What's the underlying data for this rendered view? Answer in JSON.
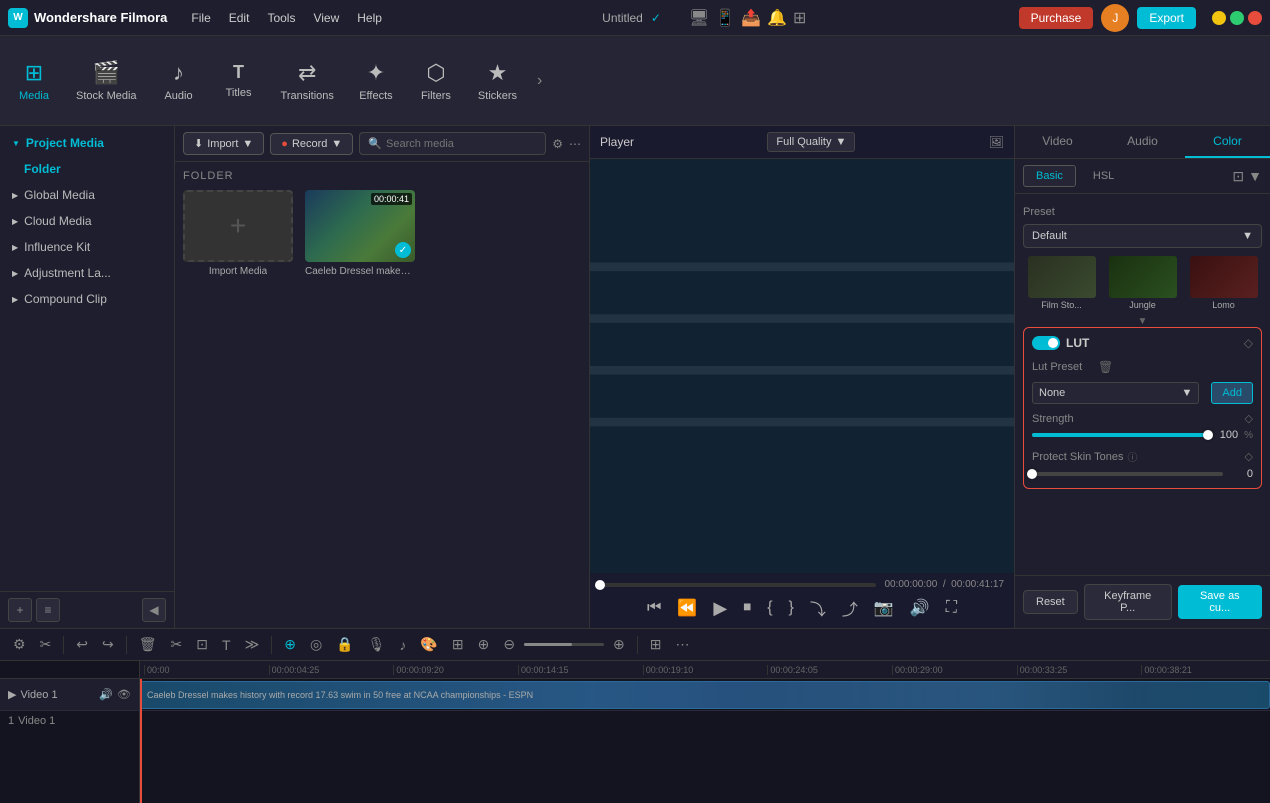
{
  "app": {
    "name": "Wondershare Filmora",
    "logo_char": "W",
    "title": "Untitled"
  },
  "titlebar": {
    "menus": [
      "File",
      "Edit",
      "Tools",
      "View",
      "Help"
    ],
    "purchase_label": "Purchase",
    "export_label": "Export",
    "status_icon": "✓"
  },
  "toolbar": {
    "items": [
      {
        "id": "media",
        "label": "Media",
        "icon": "⊞",
        "active": true
      },
      {
        "id": "stock-media",
        "label": "Stock Media",
        "icon": "🎬"
      },
      {
        "id": "audio",
        "label": "Audio",
        "icon": "♪"
      },
      {
        "id": "titles",
        "label": "Titles",
        "icon": "T"
      },
      {
        "id": "transitions",
        "label": "Transitions",
        "icon": "⇄"
      },
      {
        "id": "effects",
        "label": "Effects",
        "icon": "✦"
      },
      {
        "id": "filters",
        "label": "Filters",
        "icon": "⬡"
      },
      {
        "id": "stickers",
        "label": "Stickers",
        "icon": "★"
      }
    ]
  },
  "left_panel": {
    "items": [
      {
        "label": "Project Media",
        "active": true,
        "expanded": true
      },
      {
        "label": "Folder",
        "is_folder": true
      },
      {
        "label": "Global Media"
      },
      {
        "label": "Cloud Media"
      },
      {
        "label": "Influence Kit"
      },
      {
        "label": "Adjustment La..."
      },
      {
        "label": "Compound Clip"
      }
    ]
  },
  "media_panel": {
    "import_label": "Import",
    "record_label": "Record",
    "search_placeholder": "Search media",
    "folder_label": "FOLDER",
    "items": [
      {
        "type": "import",
        "label": "Import Media",
        "has_content": false
      },
      {
        "type": "video",
        "label": "Caeleb Dressel makes ...",
        "duration": "00:00:41",
        "has_content": true
      }
    ]
  },
  "preview": {
    "label": "Player",
    "quality": "Full Quality",
    "current_time": "00:00:00:00",
    "total_time": "00:00:41:17",
    "progress": 0
  },
  "right_panel": {
    "tabs": [
      "Video",
      "Audio",
      "Color"
    ],
    "active_tab": "Color",
    "sub_tabs": [
      "Basic",
      "HSL"
    ],
    "active_sub_tab": "Basic",
    "preset": {
      "label": "Preset",
      "default_value": "Default",
      "items": [
        {
          "name": "Film Sto...",
          "color1": "#2a3a2a",
          "color2": "#3a4a3a"
        },
        {
          "name": "Jungle",
          "color1": "#1a3a1a",
          "color2": "#2a5a2a"
        },
        {
          "name": "Lomo",
          "color1": "#3a1a1a",
          "color2": "#5a2a2a"
        }
      ]
    },
    "lut": {
      "enabled": true,
      "title": "LUT",
      "lut_preset_label": "Lut Preset",
      "none_option": "None",
      "add_label": "Add",
      "strength_label": "Strength",
      "strength_value": "100",
      "strength_unit": "%",
      "skin_tones_label": "Protect Skin Tones",
      "skin_value": "0"
    },
    "footer": {
      "reset_label": "Reset",
      "keyframe_label": "Keyframe P...",
      "saveas_label": "Save as cu..."
    }
  },
  "timeline": {
    "ruler_marks": [
      "00:00",
      "00:00:04:25",
      "00:00:09:20",
      "00:00:14:15",
      "00:00:19:10",
      "00:00:24:05",
      "00:00:29:00",
      "00:00:33:25",
      "00:00:38:21"
    ],
    "tracks": [
      {
        "label": "Video 1",
        "type": "video",
        "has_clip": true,
        "clip_text": "Caeleb Dressel makes history with record 17.63 swim in 50 free at NCAA championships - ESPN"
      }
    ],
    "track_number": "1"
  }
}
